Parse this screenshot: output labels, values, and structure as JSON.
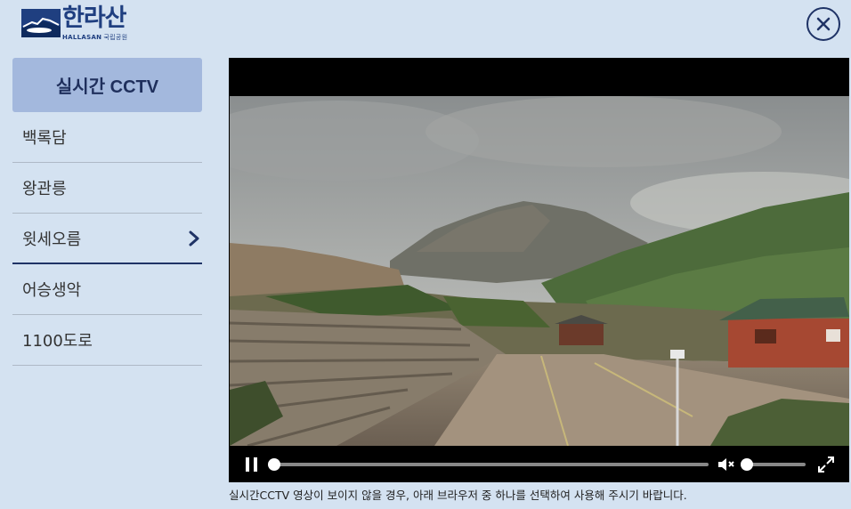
{
  "brand": {
    "name": "한라산",
    "sub": "HALLASAN",
    "sub_small": "국립공원"
  },
  "sidebar": {
    "title": "실시간 CCTV",
    "items": [
      {
        "label": "백록담",
        "active": false
      },
      {
        "label": "왕관릉",
        "active": false
      },
      {
        "label": "윗세오름",
        "active": true
      },
      {
        "label": "어승생악",
        "active": false
      },
      {
        "label": "1100도로",
        "active": false
      }
    ]
  },
  "player": {
    "state": "playing",
    "progress": 0,
    "muted": true,
    "volume": 0
  },
  "notice": "실시간CCTV 영상이 보이지 않을 경우, 아래 브라우저 중 하나를 선택하여 사용해 주시기 바랍니다.",
  "colors": {
    "background": "#d4e2f1",
    "sidebar_header": "#a3b8dd",
    "accent": "#1f3366"
  }
}
